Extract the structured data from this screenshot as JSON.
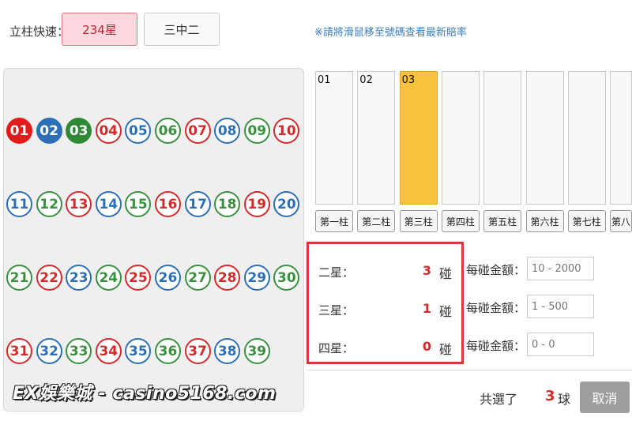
{
  "topbar": {
    "quick_label": "立柱快速：",
    "mode_active": "234星",
    "mode_other": "三中二",
    "hint": "※請將滑鼠移至號碼查看最新賠率"
  },
  "balls": [
    {
      "n": "01",
      "c": "sel-red"
    },
    {
      "n": "02",
      "c": "sel-blue"
    },
    {
      "n": "03",
      "c": "sel-green"
    },
    {
      "n": "04",
      "c": "red"
    },
    {
      "n": "05",
      "c": "blue"
    },
    {
      "n": "06",
      "c": "green"
    },
    {
      "n": "07",
      "c": "red"
    },
    {
      "n": "08",
      "c": "blue"
    },
    {
      "n": "09",
      "c": "green"
    },
    {
      "n": "10",
      "c": "red"
    },
    {
      "n": "11",
      "c": "blue"
    },
    {
      "n": "12",
      "c": "green"
    },
    {
      "n": "13",
      "c": "red"
    },
    {
      "n": "14",
      "c": "blue"
    },
    {
      "n": "15",
      "c": "green"
    },
    {
      "n": "16",
      "c": "red"
    },
    {
      "n": "17",
      "c": "blue"
    },
    {
      "n": "18",
      "c": "green"
    },
    {
      "n": "19",
      "c": "red"
    },
    {
      "n": "20",
      "c": "blue"
    },
    {
      "n": "21",
      "c": "green"
    },
    {
      "n": "22",
      "c": "red"
    },
    {
      "n": "23",
      "c": "blue"
    },
    {
      "n": "24",
      "c": "green"
    },
    {
      "n": "25",
      "c": "red"
    },
    {
      "n": "26",
      "c": "blue"
    },
    {
      "n": "27",
      "c": "green"
    },
    {
      "n": "28",
      "c": "red"
    },
    {
      "n": "29",
      "c": "blue"
    },
    {
      "n": "30",
      "c": "green"
    },
    {
      "n": "31",
      "c": "red"
    },
    {
      "n": "32",
      "c": "blue"
    },
    {
      "n": "33",
      "c": "green"
    },
    {
      "n": "34",
      "c": "red"
    },
    {
      "n": "35",
      "c": "blue"
    },
    {
      "n": "36",
      "c": "green"
    },
    {
      "n": "37",
      "c": "red"
    },
    {
      "n": "38",
      "c": "blue"
    },
    {
      "n": "39",
      "c": "green"
    }
  ],
  "pillars": [
    {
      "num": "01",
      "label": "第一柱",
      "active": false
    },
    {
      "num": "02",
      "label": "第二柱",
      "active": false
    },
    {
      "num": "03",
      "label": "第三柱",
      "active": true
    },
    {
      "num": "",
      "label": "第四柱",
      "active": false
    },
    {
      "num": "",
      "label": "第五柱",
      "active": false
    },
    {
      "num": "",
      "label": "第六柱",
      "active": false
    },
    {
      "num": "",
      "label": "第七柱",
      "active": false
    },
    {
      "num": "",
      "label": "第八",
      "active": false
    }
  ],
  "stars": [
    {
      "label": "二星：",
      "count": "3",
      "unit": "碰",
      "amount_label": "每碰金額：",
      "placeholder": "10 - 2000"
    },
    {
      "label": "三星：",
      "count": "1",
      "unit": "碰",
      "amount_label": "每碰金額：",
      "placeholder": "1 - 500"
    },
    {
      "label": "四星：",
      "count": "0",
      "unit": "碰",
      "amount_label": "每碰金額：",
      "placeholder": "0 - 0"
    }
  ],
  "footer": {
    "total_label": "共選了",
    "total_count": "3",
    "total_unit": "球",
    "cancel": "取消"
  },
  "watermark": "EX娛樂城 - casino5168.com",
  "colors": {
    "red": "#d42a2a",
    "blue": "#2d6fb7",
    "green": "#3a9040",
    "pillar_active": "#f9c23c"
  }
}
